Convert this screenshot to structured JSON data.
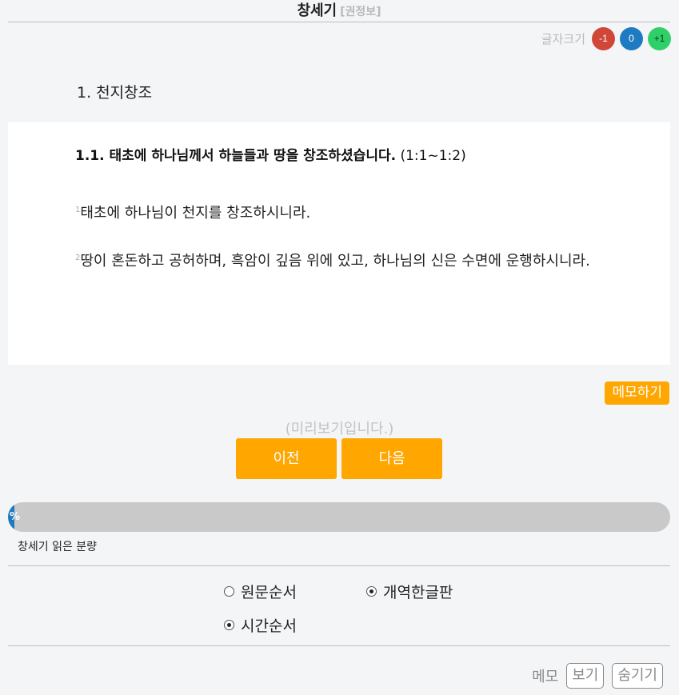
{
  "header": {
    "title": "창세기",
    "volume": "[권정보]"
  },
  "font_size": {
    "label": "글자크기",
    "minus": "-1",
    "reset": "0",
    "plus": "+1"
  },
  "chapter": {
    "heading": "1. 천지창조",
    "section_title": "1.1. 태초에 하나님께서 하늘들과 땅을 창조하셨습니다.",
    "section_ref": "(1:1~1:2)",
    "verses": [
      {
        "num": "1",
        "text": "태초에 하나님이 천지를 창조하시니라."
      },
      {
        "num": "2",
        "text": "땅이 혼돈하고 공허하며, 흑암이 깊음 위에 있고, 하나님의 신은 수면에 운행하시니라."
      }
    ]
  },
  "memo_button": "메모하기",
  "preview_text": "(미리보기입니다.)",
  "nav": {
    "prev": "이전",
    "next": "다음"
  },
  "progress": {
    "percent": 1,
    "label": "%",
    "caption": "창세기 읽은 분량"
  },
  "order_options": [
    {
      "label": "원문순서",
      "checked": false
    },
    {
      "label": "개역한글판",
      "checked": true
    },
    {
      "label": "시간순서",
      "checked": true
    }
  ],
  "memo_bar": {
    "label": "메모",
    "show": "보기",
    "hide": "숨기기"
  },
  "colors": {
    "accent": "#ffa600",
    "blue": "#1f7bc1",
    "red": "#d0473a",
    "green": "#2fd06a"
  }
}
